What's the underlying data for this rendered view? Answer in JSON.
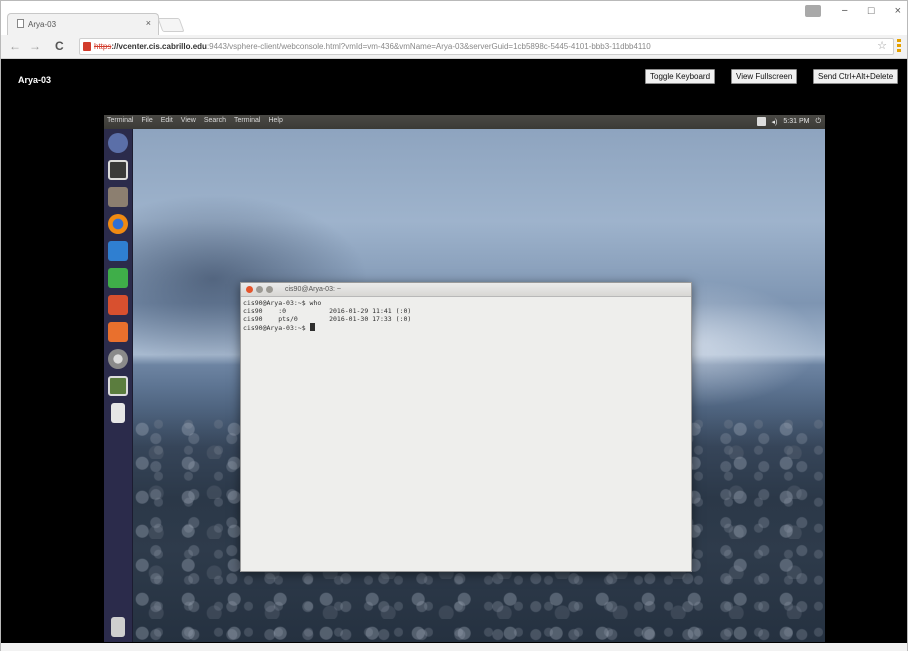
{
  "browser": {
    "tab": {
      "title": "Arya-03",
      "close": "×"
    },
    "window_controls": {
      "minimize": "−",
      "maximize": "□",
      "close": "×"
    },
    "nav": {
      "back": "←",
      "forward": "→",
      "reload": "C"
    },
    "address": {
      "scheme": "https",
      "host": "://vcenter.cis.cabrillo.edu",
      "path": ":9443/vsphere-client/webconsole.html?vmId=vm-436&vmName=Arya-03&serverGuid=1cb5898c-5445-4101-bbb3-11dbb4110"
    },
    "star": "☆"
  },
  "console": {
    "vm_name": "Arya-03",
    "buttons": {
      "toggle_keyboard": "Toggle Keyboard",
      "view_fullscreen": "View Fullscreen",
      "send_cad": "Send Ctrl+Alt+Delete"
    }
  },
  "guest": {
    "menubar": [
      "Terminal",
      "File",
      "Edit",
      "View",
      "Search",
      "Terminal",
      "Help"
    ],
    "tray": {
      "volume": "◂)",
      "clock": "5:31 PM",
      "power": "⏻"
    },
    "terminal": {
      "title": "cis90@Arya-03: ~",
      "lines": [
        "cis90@Arya-03:~$ who",
        "cis90    :0           2016-01-29 11:41 (:0)",
        "cis90    pts/0        2016-01-30 17:33 (:0)",
        "cis90@Arya-03:~$ "
      ]
    }
  },
  "colors": {
    "launcher": "#2b2b4b",
    "topbar": "#3b3a36",
    "terminal_bg": "#eeeeec",
    "close_dot": "#e5542b"
  }
}
